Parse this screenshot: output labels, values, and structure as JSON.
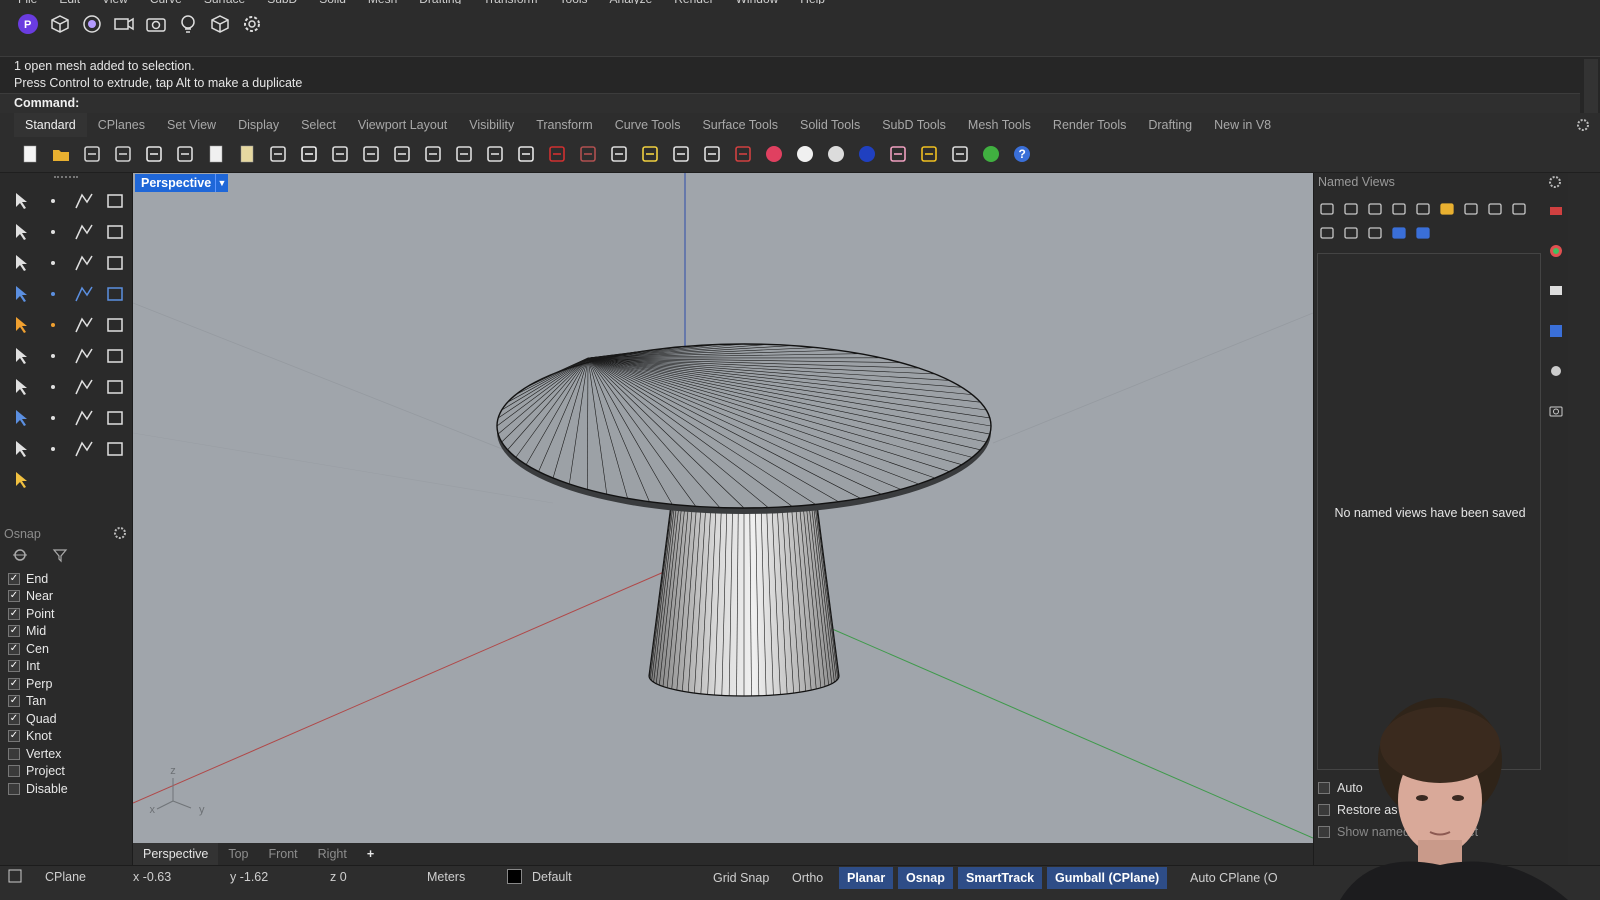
{
  "menu": [
    "File",
    "Edit",
    "View",
    "Curve",
    "Surface",
    "SubD",
    "Solid",
    "Mesh",
    "Drafting",
    "Transform",
    "Tools",
    "Analyze",
    "Render",
    "Window",
    "Help"
  ],
  "top_icons": [
    "rhino-logo-icon",
    "cube-icon",
    "target-icon",
    "camera-record-icon",
    "camera-icon",
    "lightbulb-icon",
    "box-icon",
    "gear-icon"
  ],
  "command": {
    "history": [
      "1 open mesh added to selection.",
      "Press Control to extrude, tap Alt to make a duplicate"
    ],
    "prompt": "Command:"
  },
  "tabs": [
    "Standard",
    "CPlanes",
    "Set View",
    "Display",
    "Select",
    "Viewport Layout",
    "Visibility",
    "Transform",
    "Curve Tools",
    "Surface Tools",
    "Solid Tools",
    "SubD Tools",
    "Mesh Tools",
    "Render Tools",
    "Drafting",
    "New in V8"
  ],
  "active_tab": "Standard",
  "viewport": {
    "title": "Perspective",
    "axis_labels": {
      "z": "z",
      "x": "x",
      "y": "y"
    }
  },
  "osnap": {
    "title": "Osnap",
    "items": [
      {
        "label": "End",
        "checked": true
      },
      {
        "label": "Near",
        "checked": true
      },
      {
        "label": "Point",
        "checked": true
      },
      {
        "label": "Mid",
        "checked": true
      },
      {
        "label": "Cen",
        "checked": true
      },
      {
        "label": "Int",
        "checked": true
      },
      {
        "label": "Perp",
        "checked": true
      },
      {
        "label": "Tan",
        "checked": true
      },
      {
        "label": "Quad",
        "checked": true
      },
      {
        "label": "Knot",
        "checked": true
      },
      {
        "label": "Vertex",
        "checked": false
      },
      {
        "label": "Project",
        "checked": false
      },
      {
        "label": "Disable",
        "checked": false
      }
    ]
  },
  "viewport_tabs": [
    "Perspective",
    "Top",
    "Front",
    "Right",
    "+"
  ],
  "named_views": {
    "title": "Named Views",
    "empty_message": "No named views have been saved",
    "options": [
      "Auto",
      "Restore as",
      "Show named view widget"
    ]
  },
  "status": {
    "cplane": "CPlane",
    "x": "x -0.63",
    "y": "y -1.62",
    "z": "z 0",
    "units": "Meters",
    "layer": "Default",
    "buttons": [
      {
        "label": "Grid Snap",
        "on": false
      },
      {
        "label": "Ortho",
        "on": false
      },
      {
        "label": "Planar",
        "on": true
      },
      {
        "label": "Osnap",
        "on": true
      },
      {
        "label": "SmartTrack",
        "on": true
      },
      {
        "label": "Gumball (CPlane)",
        "on": true
      },
      {
        "label": "Auto CPlane (O",
        "on": false
      }
    ]
  },
  "colors": {
    "viewport_bg": "#a0a5ab",
    "active_blue": "#1f67d8",
    "status_on": "#2e4d87",
    "x_axis": "#c03a3a",
    "y_axis": "#2e9e3e",
    "z_axis": "#2b3f9e"
  }
}
